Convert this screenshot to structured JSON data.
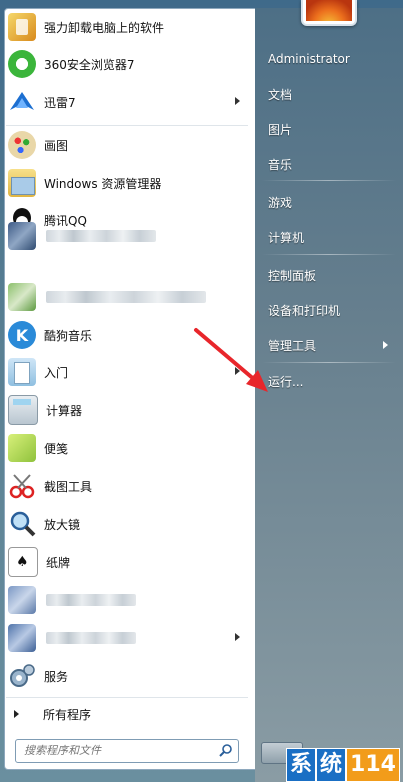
{
  "left_menu": {
    "pinned": [
      {
        "label": "强力卸载电脑上的软件",
        "icon": "uninstall-icon"
      },
      {
        "label": "360安全浏览器7",
        "icon": "browser-360-icon"
      },
      {
        "label": "迅雷7",
        "icon": "xunlei-icon",
        "submenu": true
      }
    ],
    "recent": [
      {
        "label": "画图",
        "icon": "paint-icon"
      },
      {
        "label": "Windows 资源管理器",
        "icon": "explorer-icon"
      },
      {
        "label": "腾讯QQ",
        "icon": "qq-icon"
      },
      {
        "label": "",
        "icon": "blurred-app-icon",
        "blurred": true
      },
      {
        "label": "",
        "icon": "blurred-app-icon",
        "blurred": true
      },
      {
        "label": "酷狗音乐",
        "icon": "kugou-icon"
      },
      {
        "label": "入门",
        "icon": "getting-started-icon",
        "submenu": true
      },
      {
        "label": "计算器",
        "icon": "calculator-icon"
      },
      {
        "label": "便笺",
        "icon": "sticky-notes-icon"
      },
      {
        "label": "截图工具",
        "icon": "snipping-tool-icon"
      },
      {
        "label": "放大镜",
        "icon": "magnifier-icon"
      },
      {
        "label": "纸牌",
        "icon": "solitaire-icon"
      },
      {
        "label": "",
        "icon": "blurred-app-icon",
        "blurred": true
      },
      {
        "label": "",
        "icon": "blurred-app-icon",
        "blurred": true,
        "submenu": true
      },
      {
        "label": "服务",
        "icon": "services-icon"
      }
    ],
    "all_programs": "所有程序",
    "search_placeholder": "搜索程序和文件"
  },
  "right_menu": {
    "items": [
      {
        "label": "Administrator"
      },
      {
        "label": "文档"
      },
      {
        "label": "图片"
      },
      {
        "label": "音乐"
      },
      {
        "label": "游戏"
      },
      {
        "label": "计算机"
      },
      {
        "label": "控制面板"
      },
      {
        "label": "设备和打印机"
      },
      {
        "label": "管理工具",
        "submenu": true
      },
      {
        "label": "运行..."
      }
    ]
  },
  "watermark": [
    "系",
    "统",
    "114"
  ],
  "colors": {
    "accent_blue": "#1a6fc4",
    "accent_orange": "#f29c1a",
    "arrow_red": "#e8262b"
  }
}
